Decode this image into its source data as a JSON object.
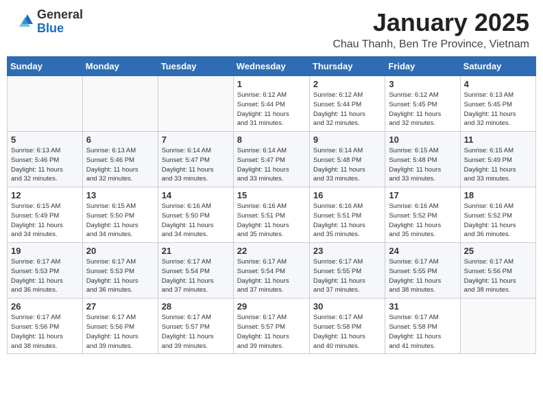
{
  "header": {
    "logo": {
      "general": "General",
      "blue": "Blue"
    },
    "title": "January 2025",
    "subtitle": "Chau Thanh, Ben Tre Province, Vietnam"
  },
  "weekdays": [
    "Sunday",
    "Monday",
    "Tuesday",
    "Wednesday",
    "Thursday",
    "Friday",
    "Saturday"
  ],
  "weeks": [
    [
      {
        "day": "",
        "info": ""
      },
      {
        "day": "",
        "info": ""
      },
      {
        "day": "",
        "info": ""
      },
      {
        "day": "1",
        "info": "Sunrise: 6:12 AM\nSunset: 5:44 PM\nDaylight: 11 hours\nand 31 minutes."
      },
      {
        "day": "2",
        "info": "Sunrise: 6:12 AM\nSunset: 5:44 PM\nDaylight: 11 hours\nand 32 minutes."
      },
      {
        "day": "3",
        "info": "Sunrise: 6:12 AM\nSunset: 5:45 PM\nDaylight: 11 hours\nand 32 minutes."
      },
      {
        "day": "4",
        "info": "Sunrise: 6:13 AM\nSunset: 5:45 PM\nDaylight: 11 hours\nand 32 minutes."
      }
    ],
    [
      {
        "day": "5",
        "info": "Sunrise: 6:13 AM\nSunset: 5:46 PM\nDaylight: 11 hours\nand 32 minutes."
      },
      {
        "day": "6",
        "info": "Sunrise: 6:13 AM\nSunset: 5:46 PM\nDaylight: 11 hours\nand 32 minutes."
      },
      {
        "day": "7",
        "info": "Sunrise: 6:14 AM\nSunset: 5:47 PM\nDaylight: 11 hours\nand 33 minutes."
      },
      {
        "day": "8",
        "info": "Sunrise: 6:14 AM\nSunset: 5:47 PM\nDaylight: 11 hours\nand 33 minutes."
      },
      {
        "day": "9",
        "info": "Sunrise: 6:14 AM\nSunset: 5:48 PM\nDaylight: 11 hours\nand 33 minutes."
      },
      {
        "day": "10",
        "info": "Sunrise: 6:15 AM\nSunset: 5:48 PM\nDaylight: 11 hours\nand 33 minutes."
      },
      {
        "day": "11",
        "info": "Sunrise: 6:15 AM\nSunset: 5:49 PM\nDaylight: 11 hours\nand 33 minutes."
      }
    ],
    [
      {
        "day": "12",
        "info": "Sunrise: 6:15 AM\nSunset: 5:49 PM\nDaylight: 11 hours\nand 34 minutes."
      },
      {
        "day": "13",
        "info": "Sunrise: 6:15 AM\nSunset: 5:50 PM\nDaylight: 11 hours\nand 34 minutes."
      },
      {
        "day": "14",
        "info": "Sunrise: 6:16 AM\nSunset: 5:50 PM\nDaylight: 11 hours\nand 34 minutes."
      },
      {
        "day": "15",
        "info": "Sunrise: 6:16 AM\nSunset: 5:51 PM\nDaylight: 11 hours\nand 35 minutes."
      },
      {
        "day": "16",
        "info": "Sunrise: 6:16 AM\nSunset: 5:51 PM\nDaylight: 11 hours\nand 35 minutes."
      },
      {
        "day": "17",
        "info": "Sunrise: 6:16 AM\nSunset: 5:52 PM\nDaylight: 11 hours\nand 35 minutes."
      },
      {
        "day": "18",
        "info": "Sunrise: 6:16 AM\nSunset: 5:52 PM\nDaylight: 11 hours\nand 36 minutes."
      }
    ],
    [
      {
        "day": "19",
        "info": "Sunrise: 6:17 AM\nSunset: 5:53 PM\nDaylight: 11 hours\nand 36 minutes."
      },
      {
        "day": "20",
        "info": "Sunrise: 6:17 AM\nSunset: 5:53 PM\nDaylight: 11 hours\nand 36 minutes."
      },
      {
        "day": "21",
        "info": "Sunrise: 6:17 AM\nSunset: 5:54 PM\nDaylight: 11 hours\nand 37 minutes."
      },
      {
        "day": "22",
        "info": "Sunrise: 6:17 AM\nSunset: 5:54 PM\nDaylight: 11 hours\nand 37 minutes."
      },
      {
        "day": "23",
        "info": "Sunrise: 6:17 AM\nSunset: 5:55 PM\nDaylight: 11 hours\nand 37 minutes."
      },
      {
        "day": "24",
        "info": "Sunrise: 6:17 AM\nSunset: 5:55 PM\nDaylight: 11 hours\nand 38 minutes."
      },
      {
        "day": "25",
        "info": "Sunrise: 6:17 AM\nSunset: 5:56 PM\nDaylight: 11 hours\nand 38 minutes."
      }
    ],
    [
      {
        "day": "26",
        "info": "Sunrise: 6:17 AM\nSunset: 5:56 PM\nDaylight: 11 hours\nand 38 minutes."
      },
      {
        "day": "27",
        "info": "Sunrise: 6:17 AM\nSunset: 5:56 PM\nDaylight: 11 hours\nand 39 minutes."
      },
      {
        "day": "28",
        "info": "Sunrise: 6:17 AM\nSunset: 5:57 PM\nDaylight: 11 hours\nand 39 minutes."
      },
      {
        "day": "29",
        "info": "Sunrise: 6:17 AM\nSunset: 5:57 PM\nDaylight: 11 hours\nand 39 minutes."
      },
      {
        "day": "30",
        "info": "Sunrise: 6:17 AM\nSunset: 5:58 PM\nDaylight: 11 hours\nand 40 minutes."
      },
      {
        "day": "31",
        "info": "Sunrise: 6:17 AM\nSunset: 5:58 PM\nDaylight: 11 hours\nand 41 minutes."
      },
      {
        "day": "",
        "info": ""
      }
    ]
  ]
}
